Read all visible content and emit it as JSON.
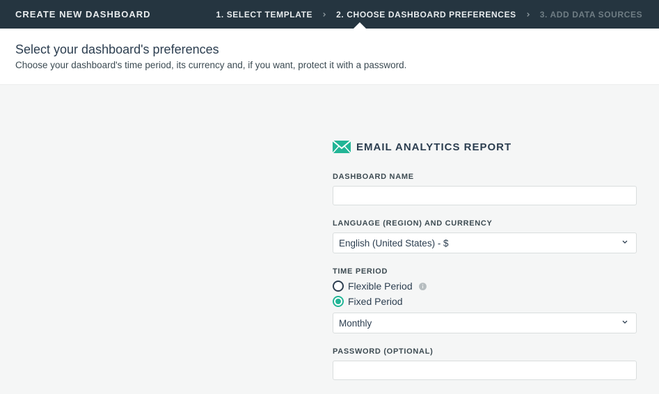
{
  "header": {
    "title": "CREATE NEW DASHBOARD",
    "steps": [
      {
        "label": "1. SELECT TEMPLATE",
        "active": false,
        "dim": false
      },
      {
        "label": "2. CHOOSE DASHBOARD PREFERENCES",
        "active": true,
        "dim": false
      },
      {
        "label": "3. ADD DATA SOURCES",
        "active": false,
        "dim": true
      }
    ]
  },
  "subheader": {
    "title": "Select your dashboard's preferences",
    "description": "Choose your dashboard's time period, its currency and, if you want, protect it with a password."
  },
  "form": {
    "section_title": "EMAIL ANALYTICS REPORT",
    "dashboard_name": {
      "label": "DASHBOARD NAME",
      "value": ""
    },
    "language": {
      "label": "LANGUAGE (REGION) AND CURRENCY",
      "selected": "English (United States) - $"
    },
    "time_period": {
      "label": "TIME PERIOD",
      "options": [
        {
          "label": "Flexible Period",
          "selected": false,
          "info": true
        },
        {
          "label": "Fixed Period",
          "selected": true,
          "info": false
        }
      ],
      "period_select": "Monthly"
    },
    "password": {
      "label": "PASSWORD (OPTIONAL)",
      "value": ""
    }
  },
  "colors": {
    "accent": "#22b596",
    "topbar": "#253540"
  }
}
